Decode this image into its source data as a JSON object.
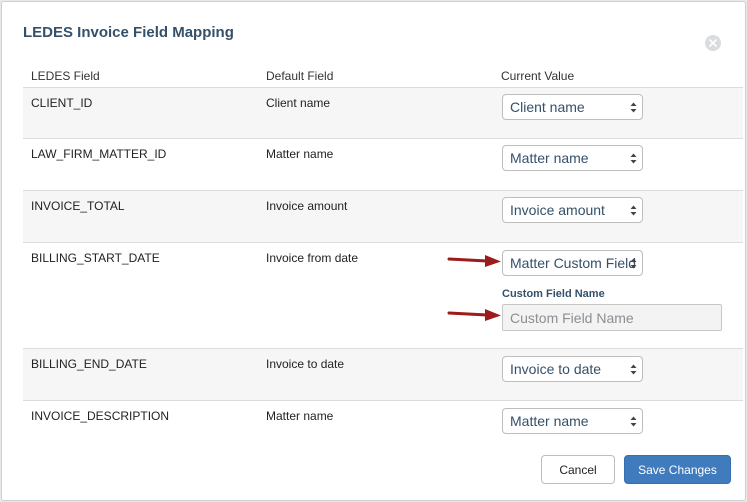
{
  "dialog": {
    "title": "LEDES Invoice Field Mapping"
  },
  "columns": {
    "ledes_field": "LEDES Field",
    "default_field": "Default Field",
    "current_value": "Current Value"
  },
  "rows": [
    {
      "ledes": "CLIENT_ID",
      "default": "Client name",
      "current": "Client name"
    },
    {
      "ledes": "LAW_FIRM_MATTER_ID",
      "default": "Matter name",
      "current": "Matter name"
    },
    {
      "ledes": "INVOICE_TOTAL",
      "default": "Invoice amount",
      "current": "Invoice amount"
    },
    {
      "ledes": "BILLING_START_DATE",
      "default": "Invoice from date",
      "current": "Matter Custom Field",
      "custom_field_label": "Custom Field Name",
      "custom_field_placeholder": "Custom Field Name",
      "custom_field_value": ""
    },
    {
      "ledes": "BILLING_END_DATE",
      "default": "Invoice to date",
      "current": "Invoice to date"
    },
    {
      "ledes": "INVOICE_DESCRIPTION",
      "default": "Matter name",
      "current": "Matter name"
    }
  ],
  "buttons": {
    "cancel": "Cancel",
    "save": "Save Changes"
  },
  "colors": {
    "title": "#34506b",
    "primary_button": "#3f7bbd",
    "annotation_arrow": "#9b1c1c"
  },
  "icons": {
    "close": "close-icon",
    "select_chevron": "chevron-updown-icon",
    "annotation": "red-arrow-icon"
  }
}
